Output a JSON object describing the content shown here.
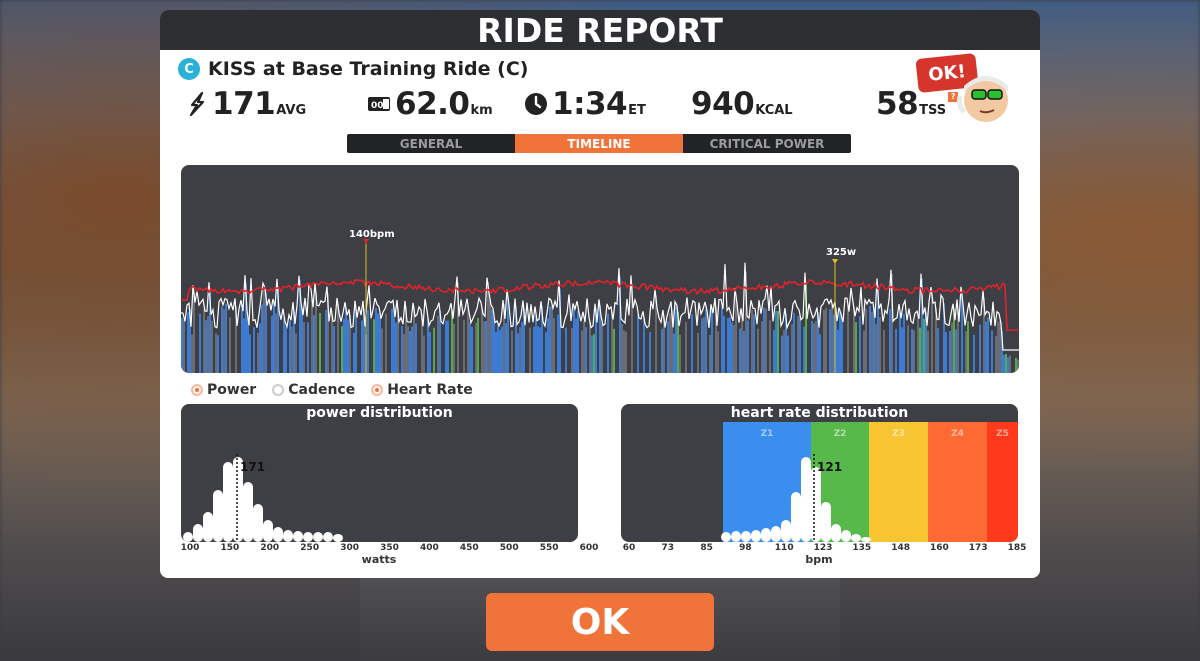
{
  "header": {
    "title": "RIDE REPORT"
  },
  "ride": {
    "category": "C",
    "title": "KISS at Base Training Ride (C)"
  },
  "stats": {
    "power": {
      "value": "171",
      "unit": "AVG",
      "icon": "lightning-icon"
    },
    "distance": {
      "value": "62.0",
      "unit": "km",
      "icon": "odometer-icon"
    },
    "time": {
      "value": "1:34",
      "unit": "ET",
      "icon": "clock-icon"
    },
    "calories": {
      "value": "940",
      "unit": "KCAL"
    },
    "tss": {
      "value": "58",
      "unit": "TSS",
      "info": "?"
    }
  },
  "tabs": [
    {
      "label": "GENERAL",
      "active": false
    },
    {
      "label": "TIMELINE",
      "active": true
    },
    {
      "label": "CRITICAL POWER",
      "active": false
    }
  ],
  "timeline": {
    "hr_peak_label": "140bpm",
    "power_peak_label": "325w"
  },
  "legend": [
    {
      "label": "Power",
      "on": true
    },
    {
      "label": "Cadence",
      "on": false
    },
    {
      "label": "Heart Rate",
      "on": true
    }
  ],
  "power_distribution": {
    "title": "power distribution",
    "avg_label": "171",
    "axis_title": "watts",
    "ticks": [
      "100",
      "150",
      "200",
      "250",
      "300",
      "350",
      "400",
      "450",
      "500",
      "550",
      "600"
    ]
  },
  "hr_distribution": {
    "title": "heart rate distribution",
    "avg_label": "121",
    "axis_title": "bpm",
    "ticks": [
      "60",
      "73",
      "85",
      "98",
      "110",
      "123",
      "135",
      "148",
      "160",
      "173",
      "185"
    ],
    "zones": [
      {
        "label": "Z1",
        "color": "#3a8ef0"
      },
      {
        "label": "Z2",
        "color": "#56b94a"
      },
      {
        "label": "Z3",
        "color": "#f7c531"
      },
      {
        "label": "Z4",
        "color": "#ff6a33"
      },
      {
        "label": "Z5",
        "color": "#ff3a1c"
      }
    ]
  },
  "avatar_bubble": "OK!",
  "ok_button": "OK",
  "colors": {
    "accent": "#f0733a",
    "power_bar": "#3d7ad1",
    "hr_line": "#e0232b",
    "panel": "#3d3f44"
  }
}
